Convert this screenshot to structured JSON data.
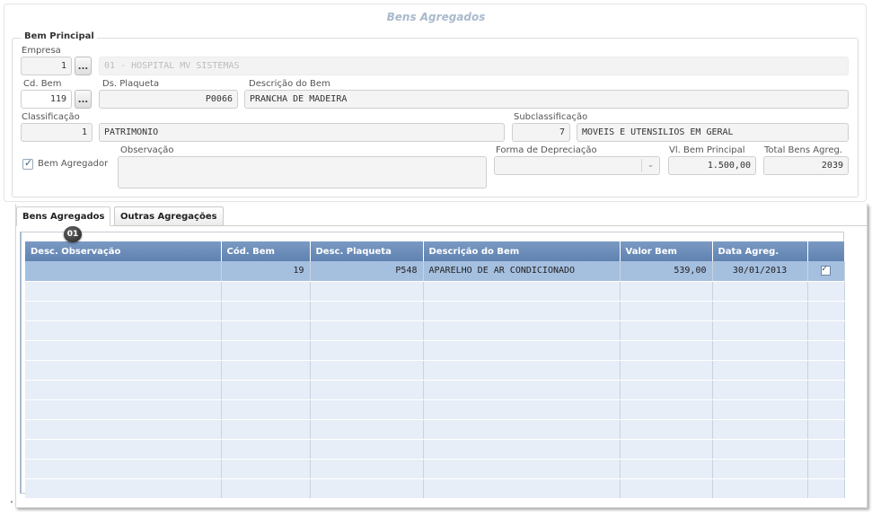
{
  "window_title": "Bens Agregados",
  "bem_principal": {
    "legend": "Bem Principal",
    "empresa": {
      "label": "Empresa",
      "code": "1",
      "dots": "...",
      "name": "01 - HOSPITAL MV SISTEMAS"
    },
    "cd_bem": {
      "label": "Cd. Bem",
      "value": "119",
      "dots": "..."
    },
    "ds_plaqueta": {
      "label": "Ds. Plaqueta",
      "value": "P0066"
    },
    "descricao_bem": {
      "label": "Descrição do Bem",
      "value": "PRANCHA DE MADEIRA"
    },
    "classificacao": {
      "label": "Classificação",
      "code": "1",
      "name": "PATRIMONIO"
    },
    "subclassificacao": {
      "label": "Subclassificação",
      "code": "7",
      "name": "MOVEIS E UTENSILIOS EM GERAL"
    },
    "bem_agregador": {
      "label": "Bem Agregador",
      "checked": true
    },
    "observacao": {
      "label": "Observação",
      "value": ""
    },
    "forma_depreciacao": {
      "label": "Forma de Depreciação",
      "value": ""
    },
    "vl_bem_principal": {
      "label": "Vl. Bem Principal",
      "value": "1.500,00"
    },
    "total_bens_agreg": {
      "label": "Total Bens Agreg.",
      "value": "2039"
    }
  },
  "tabs": [
    {
      "label": "Bens Agregados",
      "active": true
    },
    {
      "label": "Outras Agregações",
      "active": false
    }
  ],
  "badge": "01",
  "grid": {
    "columns": [
      "Desc. Observação",
      "Cód. Bem",
      "Desc. Plaqueta",
      "Descrição do Bem",
      "Valor Bem",
      "Data Agreg.",
      ""
    ],
    "rows": [
      {
        "observacao": "",
        "cod_bem": "19",
        "plaqueta": "P548",
        "descricao": "APARELHO DE AR CONDICIONADO",
        "valor": "539,00",
        "data": "30/01/2013",
        "checked": true
      }
    ]
  }
}
